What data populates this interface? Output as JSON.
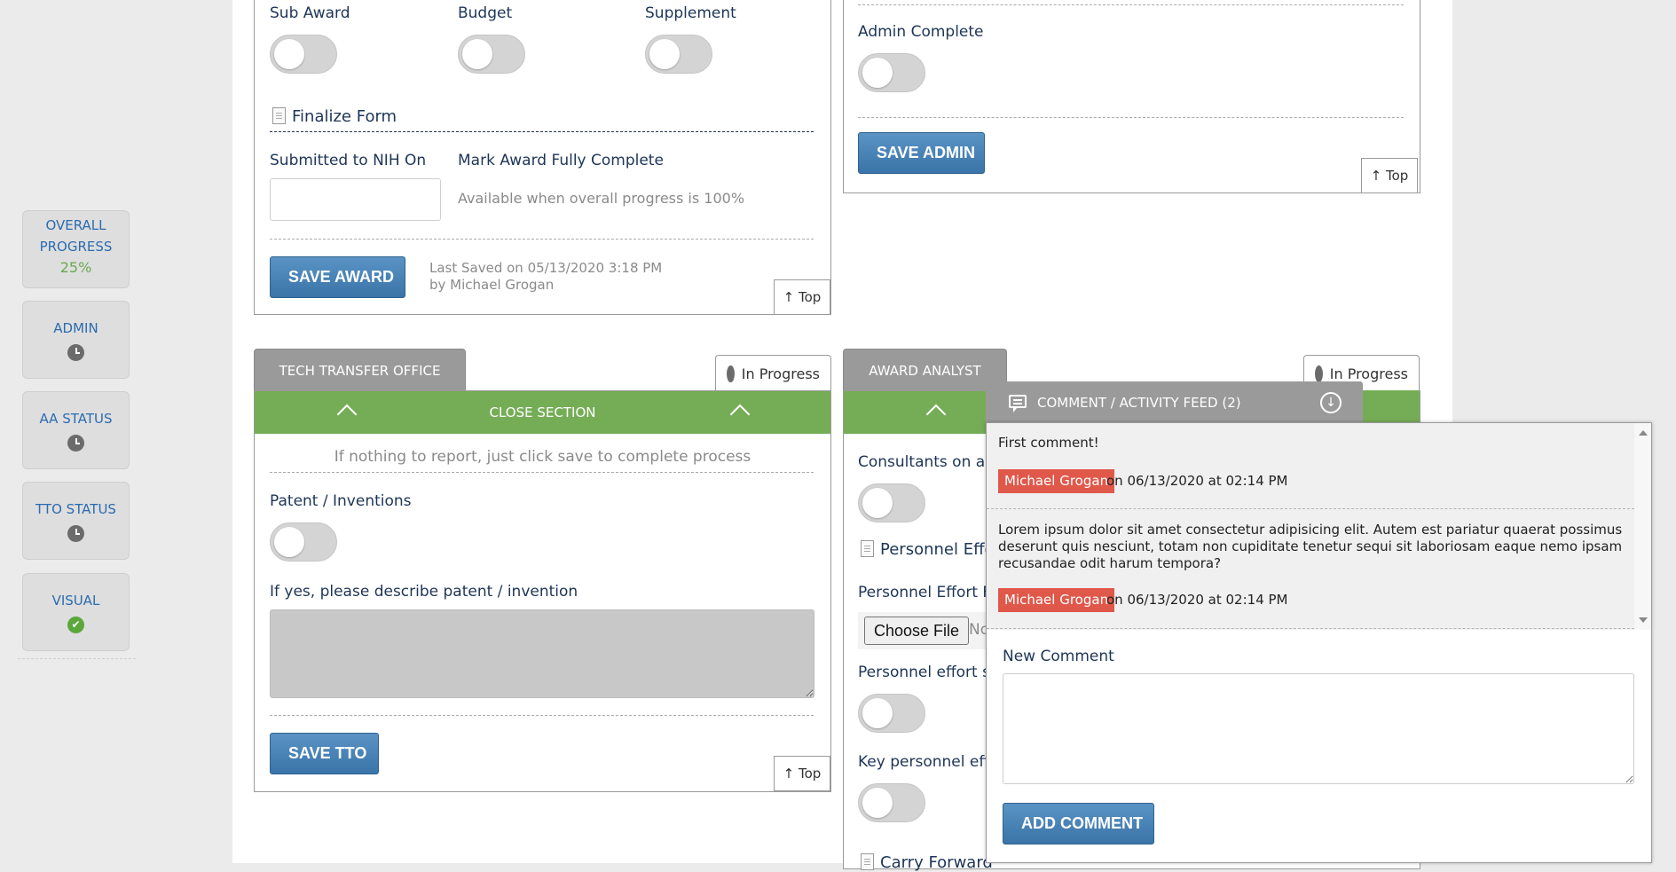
{
  "status_nav": {
    "overall": {
      "label": "Overall Progress",
      "value": "25%"
    },
    "items": [
      {
        "label": "Admin",
        "icon": "clock-icon"
      },
      {
        "label": "AA Status",
        "icon": "clock-icon"
      },
      {
        "label": "TTO Status",
        "icon": "clock-icon"
      },
      {
        "label": "Visual",
        "icon": "check-circle-icon"
      }
    ]
  },
  "award_panel": {
    "toggles": [
      {
        "label": "Sub Award",
        "on": false
      },
      {
        "label": "Budget",
        "on": false
      },
      {
        "label": "Supplement",
        "on": false
      }
    ],
    "finalize_heading": "Finalize Form",
    "submitted_label": "Submitted to NIH On",
    "submitted_value": "",
    "mark_complete_label": "Mark Award Fully Complete",
    "mark_complete_note": "Available when overall progress is 100%",
    "save_label": "SAVE AWARD",
    "last_saved_line1": "Last Saved on 05/13/2020 3:18 PM",
    "last_saved_line2": "by Michael Grogan",
    "top_link": "Top"
  },
  "admin_panel": {
    "admin_complete_label": "Admin Complete",
    "admin_complete_on": false,
    "save_label": "SAVE ADMIN",
    "top_link": "Top"
  },
  "tto_section": {
    "tab_label": "Tech Transfer Office",
    "status": "In Progress",
    "close_label": "Close Section",
    "hint": "If nothing to report, just click save to complete process",
    "patent_label": "Patent / Inventions",
    "patent_on": false,
    "describe_label": "If yes, please describe patent / invention",
    "describe_value": "",
    "save_label": "SAVE TTO",
    "top_link": "Top"
  },
  "aa_section": {
    "tab_label": "Award Analyst",
    "status": "In Progress",
    "consultants_label": "Consultants on aw",
    "personnel_heading": "Personnel Effor",
    "personnel_file_label": "Personnel Effort Fi",
    "choose_file_label": "Choose File",
    "no_file_text": "No",
    "personnel_sent_label": "Personnel effort se",
    "key_personnel_label": "Key personnel effo",
    "carry_forward_label": "Carry Forward"
  },
  "comment_feed": {
    "title": "Comment / Activity Feed (2)",
    "comments": [
      {
        "text": "First comment!",
        "author": "Michael Grogan",
        "meta": "on 06/13/2020 at 02:14 PM"
      },
      {
        "text": "Lorem ipsum dolor sit amet consectetur adipisicing elit. Autem est pariatur quaerat possimus deserunt quis nesciunt, totam non cupiditate tenetur sequi sit laboriosam eaque nemo ipsam recusandae odit harum tempora?",
        "author": "Michael Grogan",
        "meta": "on 06/13/2020 at 02:14 PM"
      }
    ],
    "new_comment_label": "New Comment",
    "new_comment_value": "",
    "add_label": "ADD COMMENT"
  },
  "colors": {
    "primary_button": "#3a74a8",
    "section_bar": "#75ad57",
    "author_tag": "#e0584a",
    "progress_value": "#6aa84f",
    "tab_gray": "#9a9a9a"
  }
}
